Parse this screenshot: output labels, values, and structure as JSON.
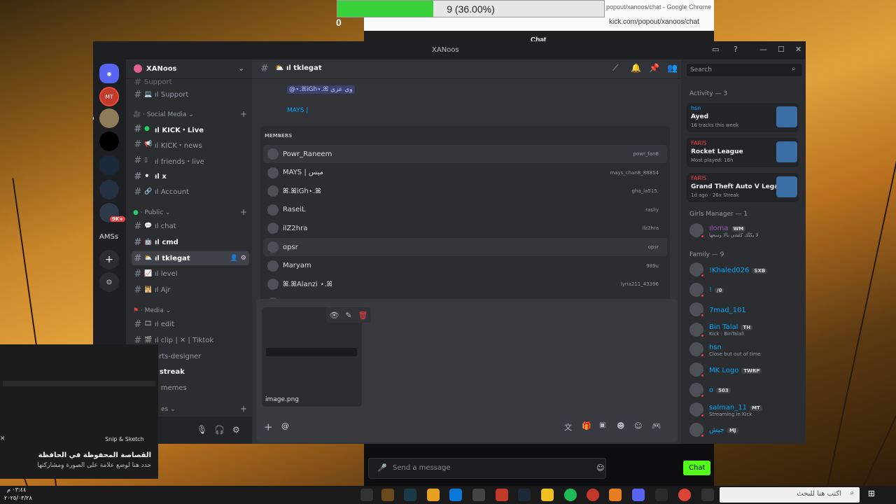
{
  "progress": {
    "text": "9 (36.00%)",
    "fraction": 0.36,
    "counter": "0"
  },
  "chrome": {
    "title": "popout/xanoos/chat - Google Chrome",
    "url": "kick.com/popout/xanoos/chat",
    "panel_title": "Chat"
  },
  "window": {
    "title": "XANoos"
  },
  "server_list": {
    "label": "AMSs",
    "badge": "9K+",
    "mt_label": "MT"
  },
  "guild": {
    "name": "XANoos"
  },
  "channels": {
    "top_partial": "Support",
    "support": "ıl Support",
    "social_category": "Social Media",
    "kick_live": "ıl KICK・Live",
    "kick_news": "ıl KICK・news",
    "friends_live": "ıl friends・live",
    "x": "ıl x",
    "account": "ıl Account",
    "public_category": "Public",
    "chat": "ıl chat",
    "cmd": "ıl cmd",
    "tklegat": "ıl tklegat",
    "level": "ıl level",
    "ajr": "ıl Ajr",
    "media_category": "Media",
    "edit": "ıl edit",
    "clip": "ıl clip | ✕ | Tiktok",
    "arts": "arts-designer",
    "streak": "l streak",
    "memes": "ıl memes",
    "last_category": "es"
  },
  "header": {
    "channel": "ıl tklegat",
    "search_placeholder": "Search"
  },
  "chat_preview": {
    "line1": "@⋆.ꕤiGh⋆.ꕤ وي عزي",
    "line2_name": "MAYS |"
  },
  "members_popup": {
    "title": "MEMBERS",
    "rows": [
      {
        "name": "Powr_Raneem",
        "user": "powr_fan8"
      },
      {
        "name": "MAYS | ميس",
        "user": "mays_chan8_88854"
      },
      {
        "name": "ꕤ.ꕤiGh⋆.ꕤ",
        "user": "gha_la515."
      },
      {
        "name": "RaseiL",
        "user": "rasliy"
      },
      {
        "name": "ilZ2hra",
        "user": "ilz2hra"
      },
      {
        "name": "opsr",
        "user": "opsr"
      },
      {
        "name": "Maryam",
        "user": "989u"
      },
      {
        "name": "ꕤ.ꕤAlanzi ⋆.ꕤ",
        "user": "lyria211_43396"
      },
      {
        "name": ".",
        "user": "v.ca"
      }
    ]
  },
  "attachment": {
    "filename": "image.png"
  },
  "activity": {
    "title": "Activity — 3",
    "items": [
      {
        "user": "hsn",
        "title": "Ayed",
        "sub": "16 tracks this week"
      },
      {
        "user": "FARIS",
        "title": "Rocket League",
        "sub": "Most played: 16h"
      },
      {
        "user": "FARIS",
        "title": "Grand Theft Auto V Legacy",
        "sub": "1d ago · 26x Streak"
      }
    ]
  },
  "girls": {
    "title": "Girls Manager — 1",
    "member": {
      "name": "ıloma",
      "tag": "WM",
      "sub": "لا يكنَّك كلشي يالا وسعها"
    }
  },
  "family": {
    "title": "Family — 9",
    "members": [
      {
        "name": "!Khaled026",
        "tag": "SXB",
        "sub": ""
      },
      {
        "name": "!",
        "tag": "/0",
        "sub": ""
      },
      {
        "name": "7mad_101",
        "tag": "",
        "sub": ""
      },
      {
        "name": "Bin Talal",
        "tag": "TH",
        "sub": "Kick : BinTalall"
      },
      {
        "name": "hsn",
        "tag": "",
        "sub": "Close but out of time"
      },
      {
        "name": "MK Logo",
        "tag": "TWRP",
        "sub": ""
      },
      {
        "name": "o",
        "tag": "503",
        "sub": ""
      },
      {
        "name": "salman_11",
        "tag": "MT",
        "sub": "Streaming in Kick"
      },
      {
        "name": "جيش",
        "tag": "MJ",
        "sub": ""
      }
    ]
  },
  "snip": {
    "app": "Snip & Sketch",
    "title": "القصاصة المحفوظة في الحافظة",
    "body": "حدد هنا لوضع علامة على الصورة ومشاركتها"
  },
  "kick_chat": {
    "placeholder": "Send a message",
    "chat_button": "Chat"
  },
  "taskbar": {
    "search": "اكتب هنا للبحث",
    "time": "٠٣:٤٤ م",
    "date": "٢٠٢٥/٠٣/٢٨"
  }
}
